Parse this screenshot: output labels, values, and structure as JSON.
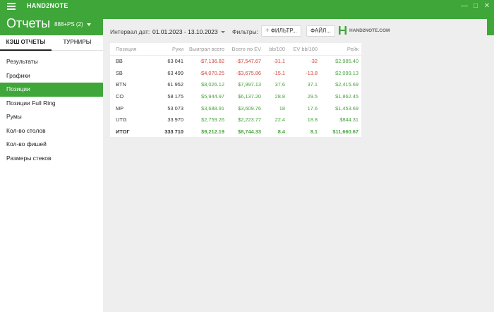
{
  "app": {
    "title": "HAND2NOTE"
  },
  "header": {
    "page_title": "Отчеты",
    "room_selector": "888+PS (2)"
  },
  "sidebar": {
    "tabs": [
      {
        "label": "КЭШ ОТЧЕТЫ",
        "active": true
      },
      {
        "label": "ТУРНИРЫ",
        "active": false
      }
    ],
    "items": [
      {
        "label": "Результаты"
      },
      {
        "label": "Графики"
      },
      {
        "label": "Позиции",
        "active": true
      },
      {
        "label": "Позиции Full Ring"
      },
      {
        "label": "Румы"
      },
      {
        "label": "Кол-во столов"
      },
      {
        "label": "Кол-во фишей"
      },
      {
        "label": "Размеры стеков"
      }
    ]
  },
  "toolbar": {
    "interval_label": "Интервал дат:",
    "date_range": "01.01.2023 - 13.10.2023",
    "filters_label": "Фильтры:",
    "filter_button": "ФИЛЬТР...",
    "file_button": "ФАЙЛ...",
    "logo_text": "HAND2NOTE.COM"
  },
  "colors": {
    "brand": "#3fa63a",
    "positive": "#4aa540",
    "negative": "#d0443a"
  },
  "table": {
    "columns": [
      "Позиция",
      "Руки",
      "Выиграл всего",
      "Всего по EV",
      "bb/100",
      "EV bb/100",
      "Рейк"
    ],
    "rows": [
      [
        "BB",
        "63 041",
        "-$7,136.82",
        "-$7,547.67",
        "-31.1",
        "-32",
        "$2,985.40"
      ],
      [
        "SB",
        "63 499",
        "-$4,070.25",
        "-$3,675.86",
        "-15.1",
        "-13.8",
        "$2,099.13"
      ],
      [
        "BTN",
        "61 952",
        "$8,026.12",
        "$7,997.13",
        "37.6",
        "37.1",
        "$2,415.69"
      ],
      [
        "CO",
        "58 175",
        "$5,944.97",
        "$6,137.20",
        "28.8",
        "29.5",
        "$1,862.45"
      ],
      [
        "MP",
        "53 073",
        "$3,688.91",
        "$3,609.76",
        "18",
        "17.6",
        "$1,453.69"
      ],
      [
        "UTG",
        "33 970",
        "$2,759.26",
        "$2,223.77",
        "22.4",
        "18.8",
        "$844.31"
      ],
      [
        "ИТОГ",
        "333 710",
        "$9,212.19",
        "$8,744.33",
        "8.4",
        "8.1",
        "$11,660.67"
      ]
    ]
  }
}
